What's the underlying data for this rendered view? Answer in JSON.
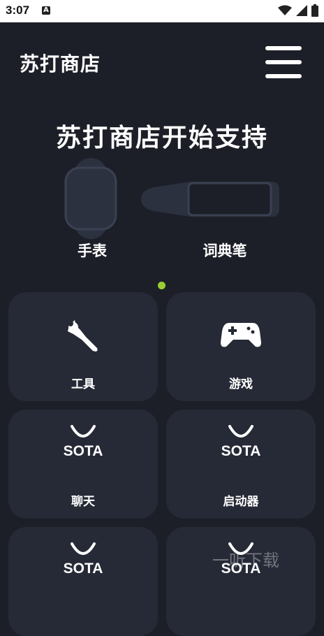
{
  "status_bar": {
    "time": "3:07",
    "notification_icon_letter": "A"
  },
  "header": {
    "title": "苏打商店",
    "menu_icon": "hamburger-menu-icon"
  },
  "headline": "苏打商店开始支持",
  "devices": [
    {
      "label": "手表",
      "icon": "watch-icon"
    },
    {
      "label": "词典笔",
      "icon": "dictionary-pen-icon"
    }
  ],
  "page_indicator_color": "#9acd32",
  "cards": [
    {
      "label": "工具",
      "icon": "wrench-icon"
    },
    {
      "label": "游戏",
      "icon": "gamepad-icon"
    },
    {
      "label": "聊天",
      "icon": "sota-logo-icon",
      "logo_text": "SOTA"
    },
    {
      "label": "启动器",
      "icon": "sota-logo-icon",
      "logo_text": "SOTA"
    },
    {
      "label": "",
      "icon": "sota-logo-icon",
      "logo_text": "SOTA"
    },
    {
      "label": "",
      "icon": "sota-logo-icon",
      "logo_text": "SOTA"
    }
  ],
  "watermark": "一听下载"
}
